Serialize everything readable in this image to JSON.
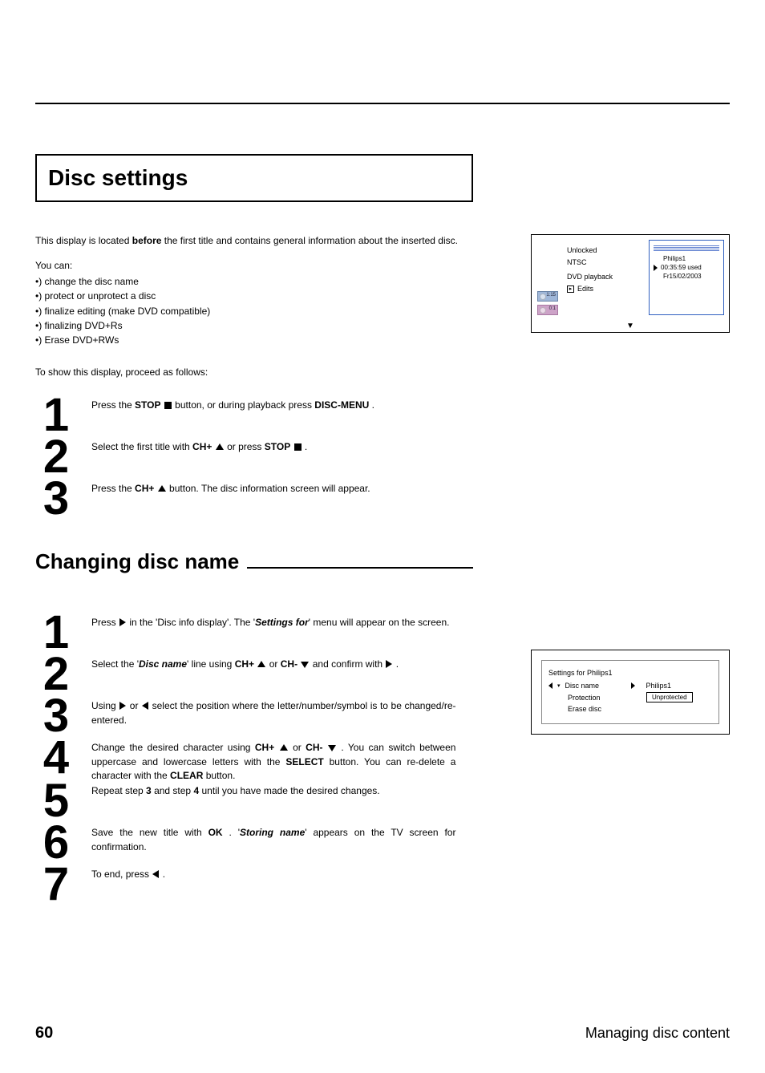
{
  "section_title": "Disc settings",
  "intro": {
    "line1_pre": "This display is located ",
    "line1_bold": "before",
    "line1_post": " the first title and contains general information about the inserted disc.",
    "youcan": "You can:",
    "bullets": [
      "•) change the disc name",
      "•) protect or unprotect a disc",
      "•) finalize editing (make DVD compatible)",
      "•) finalizing DVD+Rs",
      "•) Erase DVD+RWs"
    ],
    "toshow": "To show this display, proceed as follows:"
  },
  "osd1": {
    "unlocked": "Unlocked",
    "ntsc": "NTSC",
    "dvd": "DVD playback",
    "edits": "Edits",
    "ph": "Philips1",
    "used": "00:35:59 used",
    "date": "Fr15/02/2003",
    "chip1": "1:15",
    "chip2": "0:1",
    "arrow": "▼"
  },
  "stepsA": {
    "n1": "1",
    "n2": "2",
    "n3": "3",
    "s1_a": "Press the ",
    "s1_stop": "STOP",
    "s1_b": " button, or during playback press ",
    "s1_dm": "DISC-MENU",
    "s1_c": " .",
    "s2_a": "Select the first title with ",
    "s2_ch": "CH+",
    "s2_b": " or press ",
    "s2_stop": "STOP",
    "s2_c": " .",
    "s3_a": "Press the ",
    "s3_ch": "CH+",
    "s3_b": " button. The disc information screen will appear."
  },
  "h2": "Changing disc name",
  "stepsB": {
    "n1": "1",
    "n2": "2",
    "n3": "3",
    "n4": "4",
    "n5": "5",
    "n6": "6",
    "n7": "7",
    "s1_a": "Press ",
    "s1_b": " in the 'Disc info display'. The '",
    "s1_sf": "Settings for",
    "s1_c": "' menu will appear on the screen.",
    "s2_a": "Select the '",
    "s2_dn": "Disc name",
    "s2_b": "' line using ",
    "s2_ch1": "CH+",
    "s2_or": " or ",
    "s2_ch2": "CH-",
    "s2_c": " and confirm with ",
    "s2_d": " .",
    "s3_a": "Using ",
    "s3_or": " or ",
    "s3_b": " select the position where the letter/number/symbol is to be changed/re-entered.",
    "s4_a": "Change the desired character using ",
    "s4_ch1": "CH+",
    "s4_or": " or ",
    "s4_ch2": "CH-",
    "s4_b": " . You can switch between uppercase and lowercase letters with the ",
    "s4_sel": "SELECT",
    "s4_c": " button. You can re-delete a character with the ",
    "s4_clr": "CLEAR",
    "s4_d": " button.",
    "s5_a": "Repeat step ",
    "s5_3": "3",
    "s5_b": " and step ",
    "s5_4": "4",
    "s5_c": " until you have made the desired changes.",
    "s6_a": "Save the new title with ",
    "s6_ok": "OK",
    "s6_b": " . '",
    "s6_sn": "Storing name",
    "s6_c": "' appears on the TV screen for confirmation.",
    "s7_a": "To end, press ",
    "s7_b": " ."
  },
  "osd2": {
    "title": "Settings for Philips1",
    "disc": "Disc name",
    "prot": "Protection",
    "erase": "Erase disc",
    "val1": "Philips1",
    "val2": "Unprotected"
  },
  "footer": {
    "page": "60",
    "chapter": "Managing disc content"
  }
}
